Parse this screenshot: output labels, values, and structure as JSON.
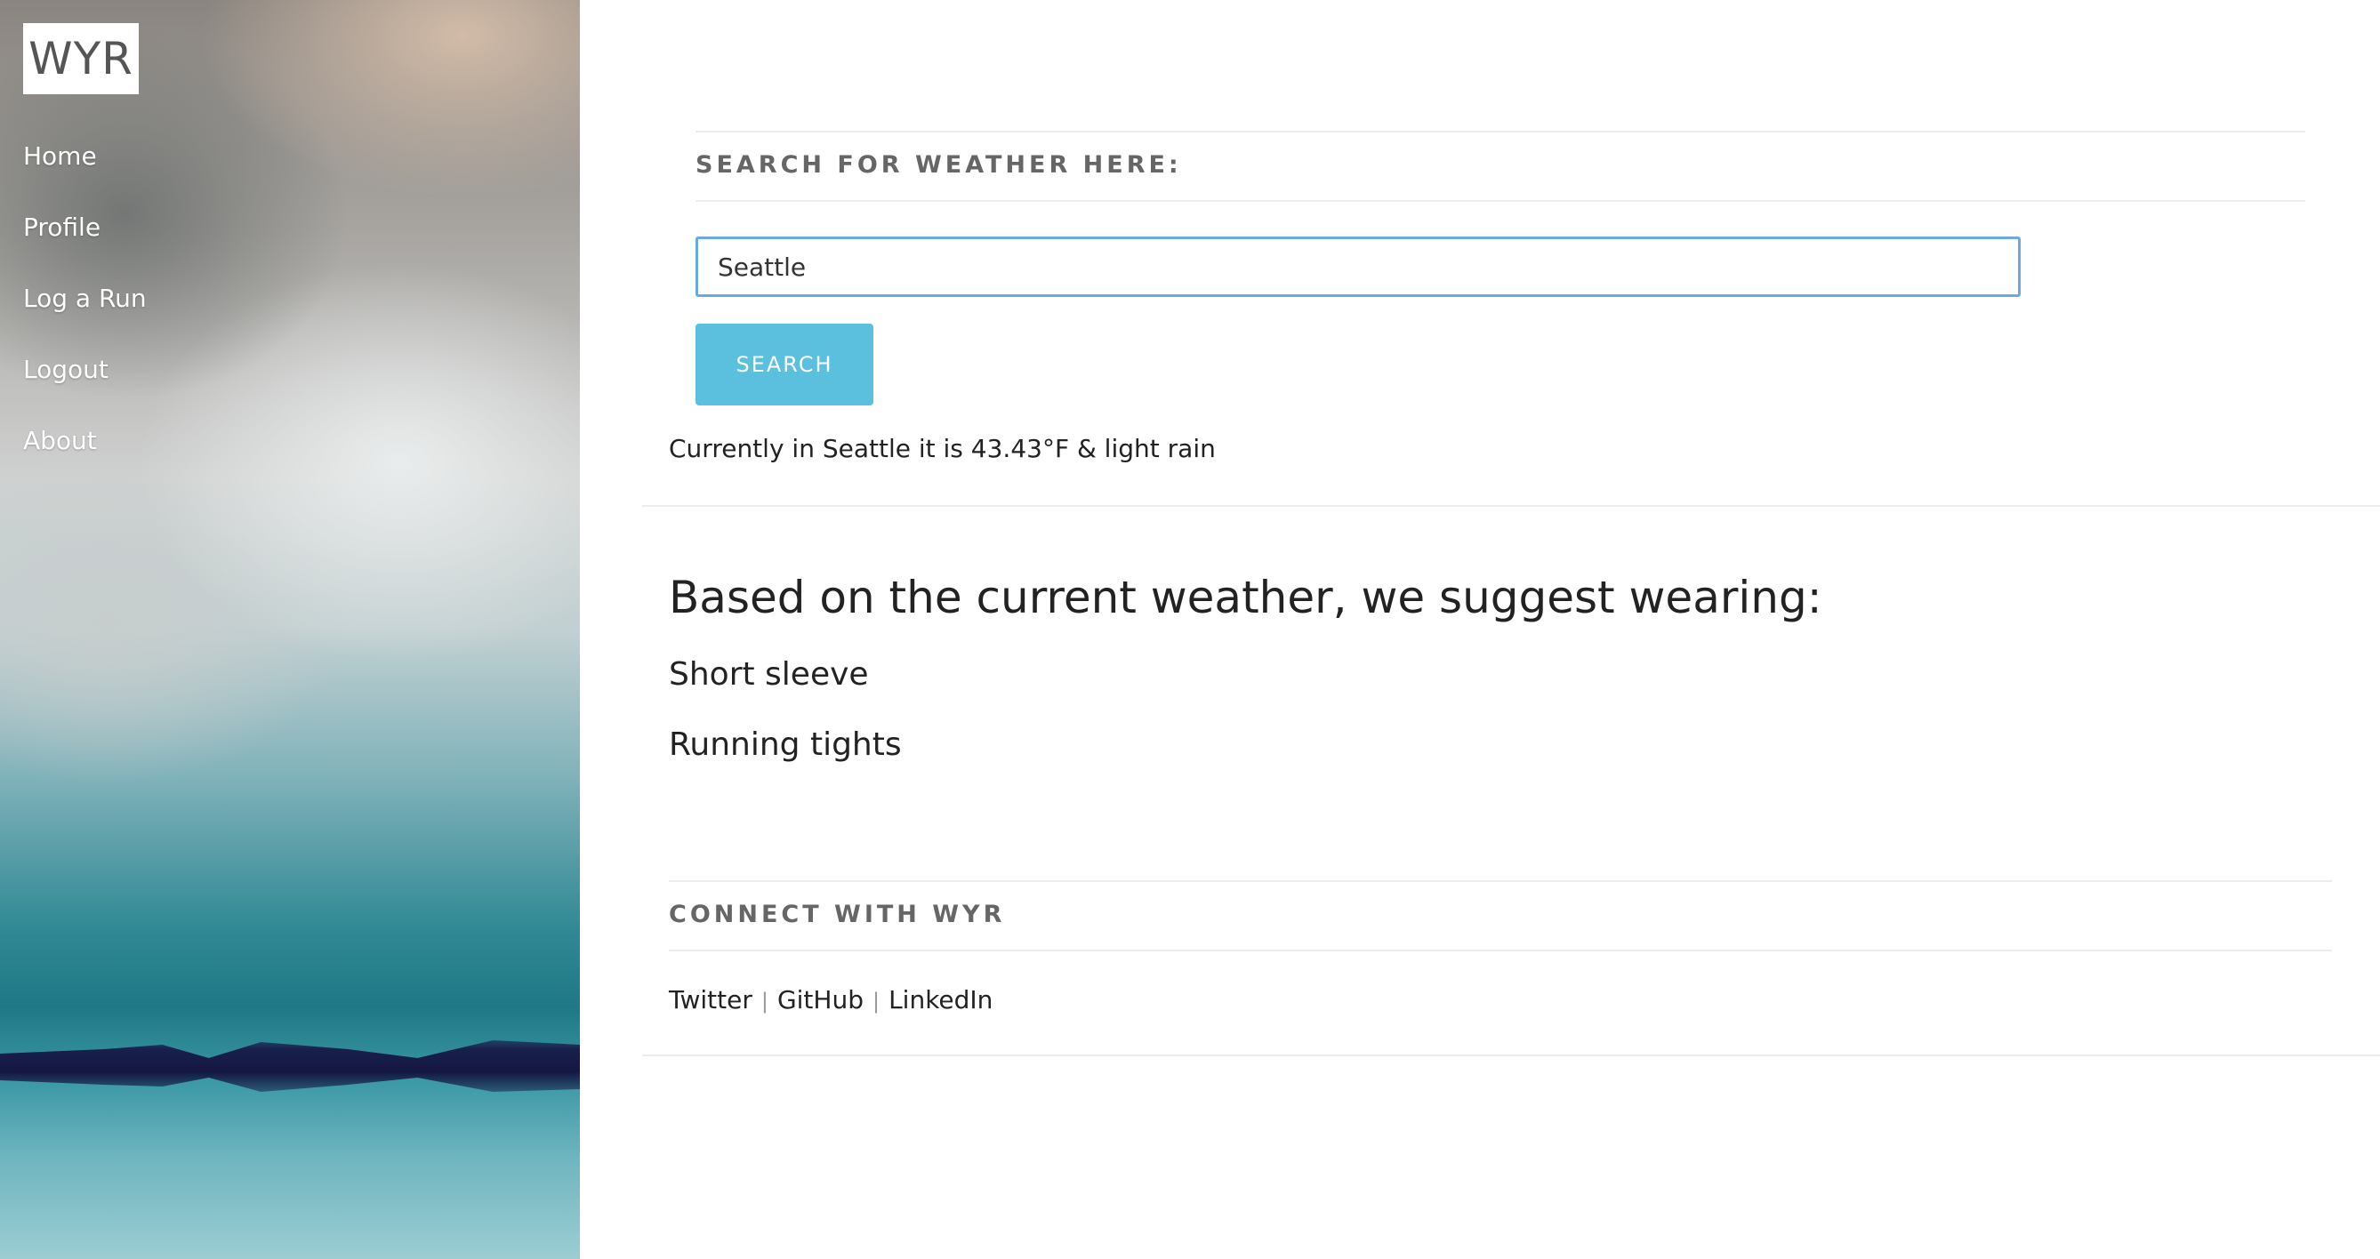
{
  "sidebar": {
    "logo": "WYR",
    "nav": [
      {
        "label": "Home"
      },
      {
        "label": "Profile"
      },
      {
        "label": "Log a Run"
      },
      {
        "label": "Logout"
      },
      {
        "label": "About"
      }
    ]
  },
  "search": {
    "title": "SEARCH FOR WEATHER HERE:",
    "value": "Seattle",
    "button_label": "SEARCH"
  },
  "weather": {
    "current_text": "Currently in Seattle it is 43.43°F & light rain"
  },
  "suggestion": {
    "heading": "Based on the current weather, we suggest wearing:",
    "items": [
      "Short sleeve",
      "Running tights"
    ]
  },
  "connect": {
    "title": "CONNECT WITH WYR",
    "links": [
      "Twitter",
      "GitHub",
      "LinkedIn"
    ],
    "separator": "|"
  },
  "colors": {
    "button": "#5bc0de",
    "input_focus_border": "#6aa8e8"
  }
}
